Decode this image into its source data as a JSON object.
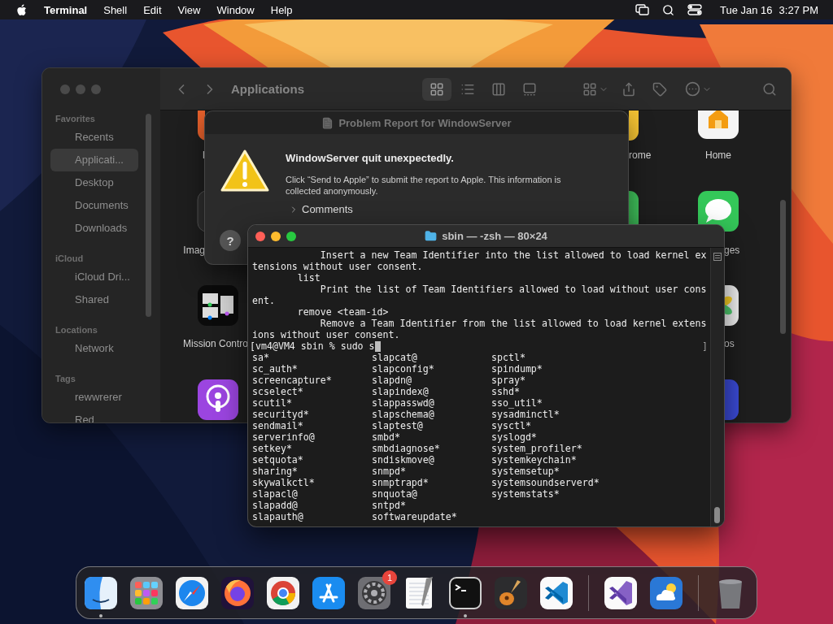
{
  "menu_bar": {
    "app_name": "Terminal",
    "menus": [
      "Shell",
      "Edit",
      "View",
      "Window",
      "Help"
    ],
    "date": "Tue Jan 16",
    "time": "3:27 PM"
  },
  "finder": {
    "title": "Applications",
    "view_buttons": [
      {
        "kind": "icons",
        "selected": true
      },
      {
        "kind": "list",
        "selected": false
      },
      {
        "kind": "columns",
        "selected": false
      },
      {
        "kind": "gallery",
        "selected": false
      }
    ],
    "sidebar": [
      {
        "heading": "Favorites",
        "items": [
          {
            "label": "Recents",
            "selected": false
          },
          {
            "label": "Applicati...",
            "selected": true
          },
          {
            "label": "Desktop",
            "selected": false
          },
          {
            "label": "Documents",
            "selected": false
          },
          {
            "label": "Downloads",
            "selected": false
          }
        ]
      },
      {
        "heading": "iCloud",
        "items": [
          {
            "label": "iCloud Dri...",
            "selected": false
          },
          {
            "label": "Shared",
            "selected": false
          }
        ]
      },
      {
        "heading": "Locations",
        "items": [
          {
            "label": "Network",
            "selected": false
          }
        ]
      },
      {
        "heading": "Tags",
        "items": [
          {
            "label": "rewwrerer",
            "selected": false
          },
          {
            "label": "Red",
            "selected": false
          }
        ]
      }
    ],
    "items": [
      {
        "kind": "orange",
        "label": "I"
      },
      {
        "kind": "dark",
        "label": "Imag"
      },
      {
        "kind": "mission",
        "label": "Mission Contro"
      },
      {
        "kind": "podcast"
      },
      {
        "kind": "yellow",
        "label": "rome"
      },
      {
        "kind": "green"
      },
      {
        "kind": "home",
        "label": "Home"
      },
      {
        "kind": "messages",
        "label": "ges"
      },
      {
        "kind": "photos",
        "label": "os"
      },
      {
        "kind": "shortcuts"
      }
    ]
  },
  "problem_report": {
    "title": "Problem Report for WindowServer",
    "heading": "WindowServer quit unexpectedly.",
    "message": "Click “Send to Apple” to submit the report to Apple. This information is collected anonymously.",
    "comments": {
      "label": "Comments",
      "expanded": false
    },
    "help": "?"
  },
  "terminal": {
    "title": "sbin — -zsh — 80×24",
    "lines": [
      "            Insert a new Team Identifier into the list allowed to load kernel ex",
      "tensions without user consent.",
      "        list",
      "            Print the list of Team Identifiers allowed to load without user cons",
      "ent.",
      "        remove <team-id>",
      "            Remove a Team Identifier from the list allowed to load kernel extens",
      "ions without user consent."
    ],
    "prompt": "[vm4@VM4 sbin % sudo s",
    "prompt_end": "]",
    "completions": [
      [
        "sa*",
        "slapcat@",
        "spctl*"
      ],
      [
        "sc_auth*",
        "slapconfig*",
        "spindump*"
      ],
      [
        "screencapture*",
        "slapdn@",
        "spray*"
      ],
      [
        "scselect*",
        "slapindex@",
        "sshd*"
      ],
      [
        "scutil*",
        "slappasswd@",
        "sso_util*"
      ],
      [
        "securityd*",
        "slapschema@",
        "sysadminctl*"
      ],
      [
        "sendmail*",
        "slaptest@",
        "sysctl*"
      ],
      [
        "serverinfo@",
        "smbd*",
        "syslogd*"
      ],
      [
        "setkey*",
        "smbdiagnose*",
        "system_profiler*"
      ],
      [
        "setquota*",
        "sndiskmove@",
        "systemkeychain*"
      ],
      [
        "sharing*",
        "snmpd*",
        "systemsetup*"
      ],
      [
        "skywalkctl*",
        "snmptrapd*",
        "systemsoundserverd*"
      ],
      [
        "slapacl@",
        "snquota@",
        "systemstats*"
      ],
      [
        "slapadd@",
        "sntpd*"
      ],
      [
        "slapauth@",
        "softwareupdate*"
      ]
    ]
  },
  "dock": {
    "apps": [
      {
        "kind": "finder",
        "running": true
      },
      {
        "kind": "launchpad",
        "running": false
      },
      {
        "kind": "safari",
        "running": false
      },
      {
        "kind": "firefox",
        "running": false
      },
      {
        "kind": "chrome",
        "running": false
      },
      {
        "kind": "appstore",
        "running": false
      },
      {
        "kind": "settings",
        "running": false,
        "badge": "1"
      },
      {
        "kind": "textedit",
        "running": false
      },
      {
        "kind": "terminal",
        "running": true
      },
      {
        "kind": "garageband",
        "running": false
      },
      {
        "kind": "vscode",
        "running": false
      },
      {
        "kind": "separator"
      },
      {
        "kind": "visualstudio",
        "running": false
      },
      {
        "kind": "weather",
        "running": false
      },
      {
        "kind": "separator"
      },
      {
        "kind": "trash",
        "running": false
      }
    ]
  }
}
